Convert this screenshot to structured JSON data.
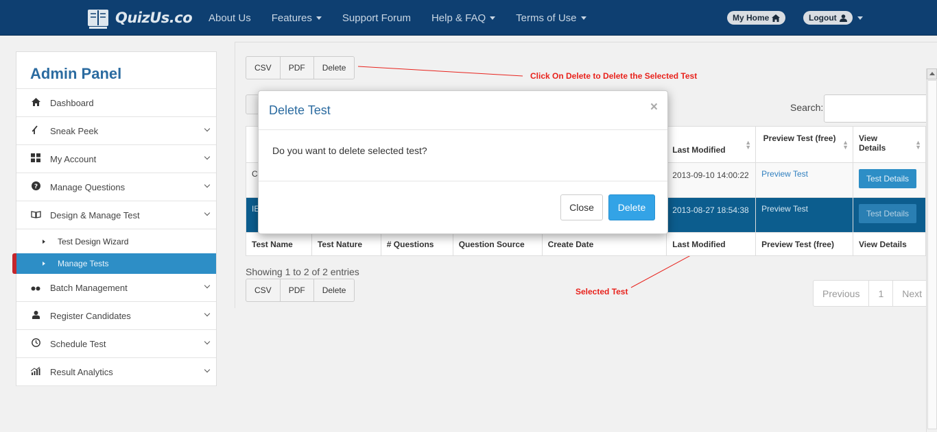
{
  "brand": {
    "logo_text": "QuizUs.co"
  },
  "nav": {
    "items": [
      {
        "label": "About Us",
        "dropdown": false
      },
      {
        "label": "Features",
        "dropdown": true
      },
      {
        "label": "Support Forum",
        "dropdown": false
      },
      {
        "label": "Help & FAQ",
        "dropdown": true
      },
      {
        "label": "Terms of Use",
        "dropdown": true
      }
    ],
    "my_home": "My Home",
    "logout": "Logout"
  },
  "sidebar": {
    "title": "Admin Panel",
    "items": [
      {
        "label": "Dashboard",
        "icon": "home-icon"
      },
      {
        "label": "Sneak Peek",
        "icon": "sneak-peek-icon"
      },
      {
        "label": "My Account",
        "icon": "grid-icon"
      },
      {
        "label": "Manage Questions",
        "icon": "question-circle-icon"
      },
      {
        "label": "Design & Manage Test",
        "icon": "book-icon"
      }
    ],
    "subitems": [
      {
        "label": "Test Design Wizard"
      },
      {
        "label": "Manage Tests"
      }
    ],
    "items_after": [
      {
        "label": "Batch Management",
        "icon": "batch-icon"
      },
      {
        "label": "Register Candidates",
        "icon": "user-icon"
      },
      {
        "label": "Schedule Test",
        "icon": "clock-icon"
      },
      {
        "label": "Result Analytics",
        "icon": "chart-icon"
      }
    ]
  },
  "toolbar": {
    "csv": "CSV",
    "pdf": "PDF",
    "delete": "Delete"
  },
  "search": {
    "label": "Search:"
  },
  "table": {
    "headers": [
      "Test Name",
      "Test Nature",
      "# Questions",
      "Question Source",
      "Create Date",
      "Last Modified",
      "Preview Test (free)",
      "View Details"
    ],
    "header_view_details": "View Details",
    "header_preview": "Preview Test (free)",
    "rows": [
      {
        "name": "C",
        "last_modified": "2013-09-10 14:00:22",
        "preview": "Preview Test",
        "details": "Test Details"
      },
      {
        "name": "IE",
        "last_modified": "2013-08-27 18:54:38",
        "preview": "Preview Test",
        "details": "Test Details"
      }
    ],
    "footer": [
      "Test Name",
      "Test Nature",
      "# Questions",
      "Question Source",
      "Create Date",
      "Last Modified",
      "Preview Test (free)",
      "View Details"
    ]
  },
  "info": {
    "showing": "Showing 1 to 2 of 2 entries"
  },
  "pager": {
    "previous": "Previous",
    "page": "1",
    "next": "Next"
  },
  "annotations": {
    "delete_hint": "Click On Delete to Delete the Selected Test",
    "selected_hint": "Selected Test"
  },
  "modal": {
    "title": "Delete Test",
    "close_x": "×",
    "body": "Do you want to delete selected test?",
    "close_button": "Close",
    "delete_button": "Delete"
  },
  "colors": {
    "navbar": "#0e3f71",
    "accent": "#2d8ec6",
    "selected_row": "#0c5d8e",
    "annotation": "#e8221c",
    "active_marker": "#c4262c"
  }
}
